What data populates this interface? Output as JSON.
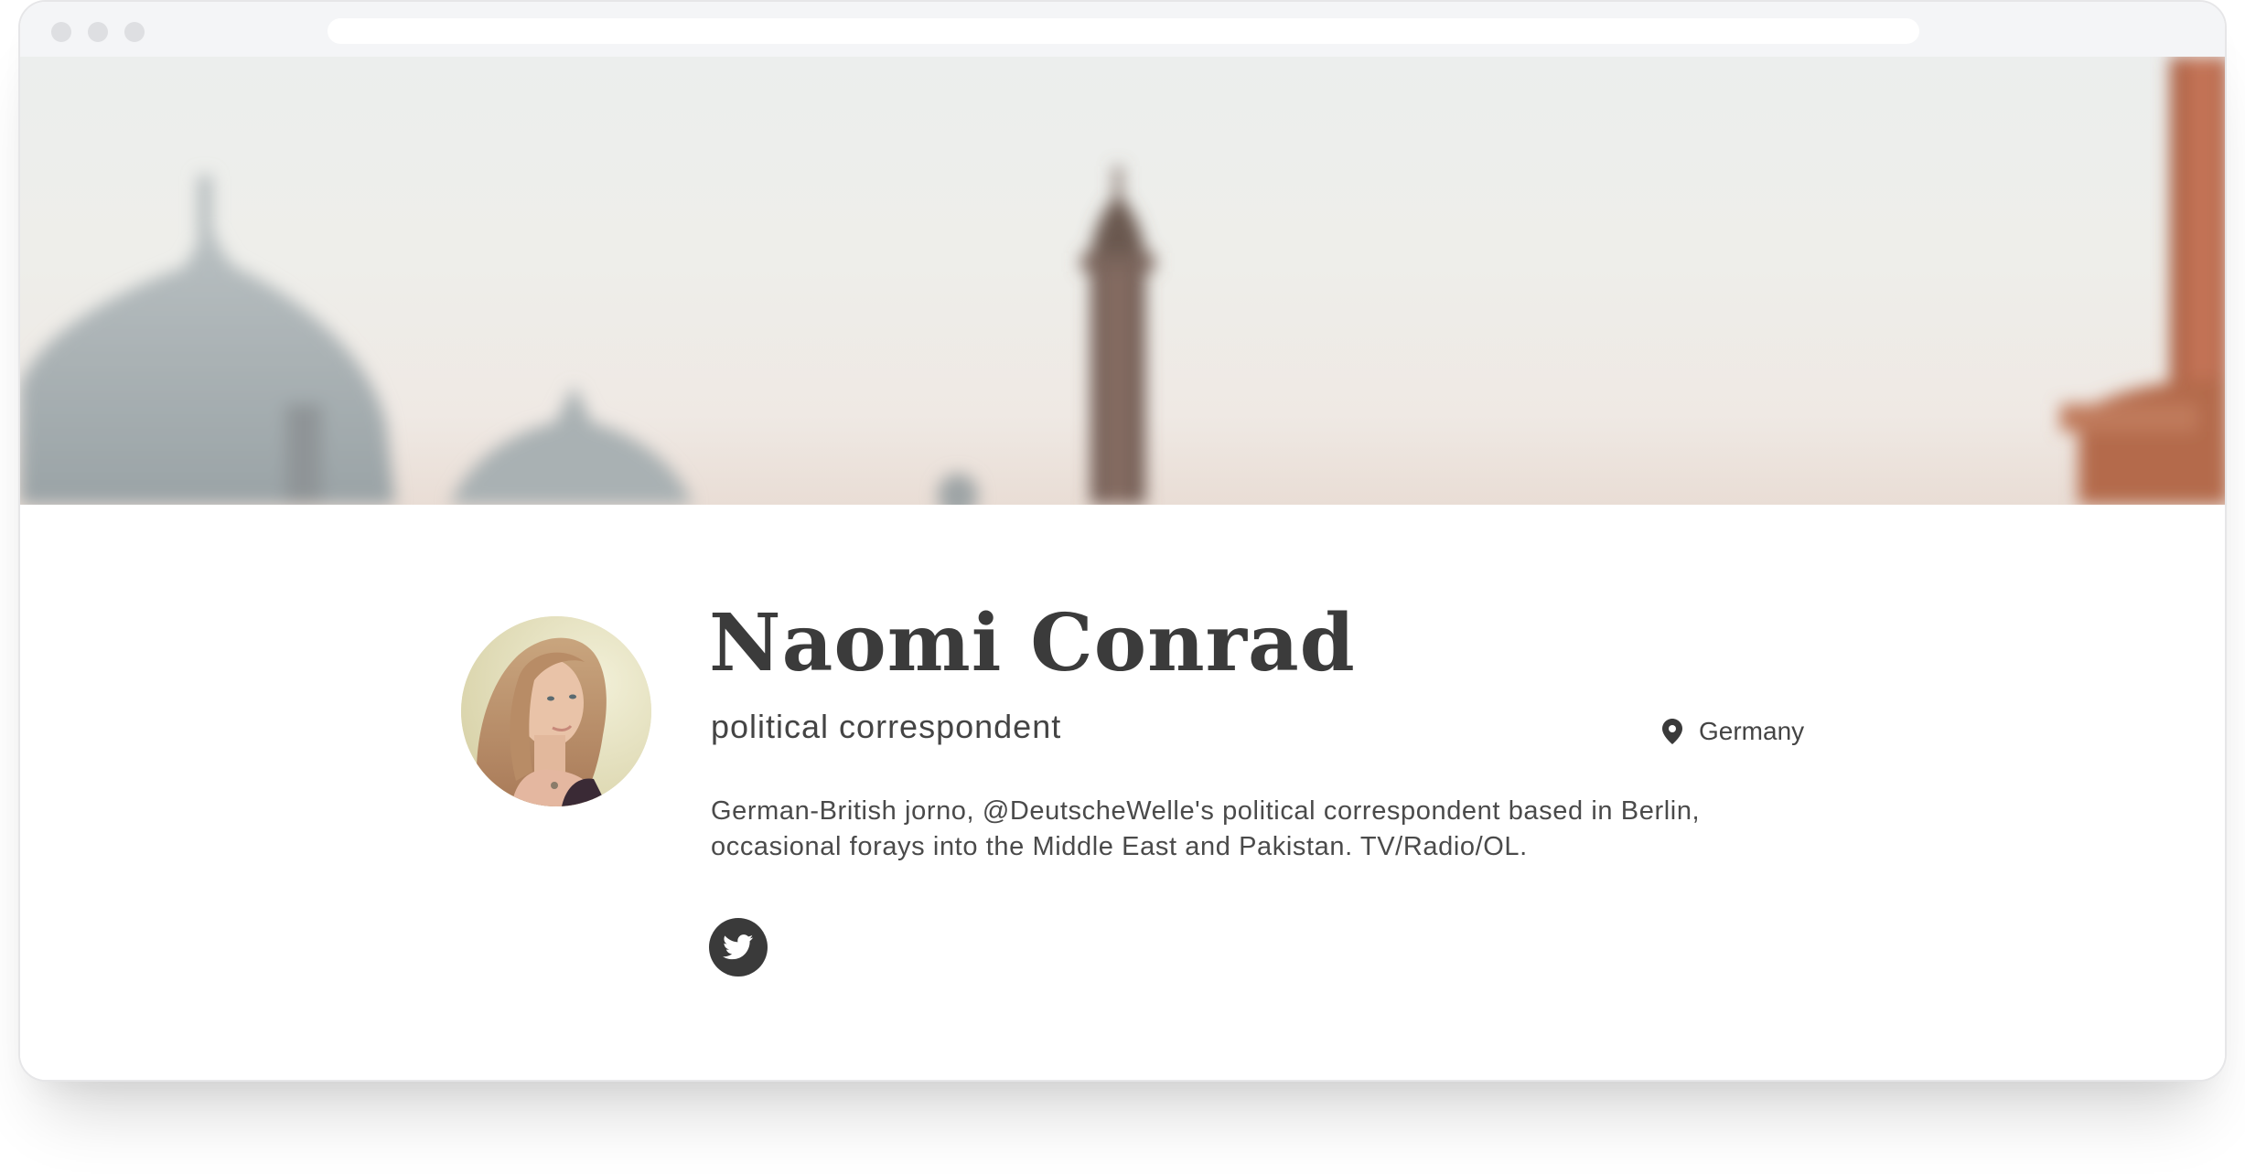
{
  "browser": {
    "controls": [
      "close-dot",
      "minimize-dot",
      "maximize-dot"
    ]
  },
  "cover": {
    "description_icon": "mosque-skyline-cover"
  },
  "profile": {
    "name": "Naomi Conrad",
    "role": "political correspondent",
    "location": "Germany",
    "bio_lines": [
      "German-British jorno, @DeutscheWelle's political correspondent based in Berlin,",
      "occasional forays into the Middle East and Pakistan. TV/Radio/OL."
    ],
    "social": [
      {
        "icon": "twitter-icon"
      }
    ]
  },
  "colors": {
    "text_dark": "#3b3b3b",
    "text_body": "#4a4a4a",
    "icon_bg": "#3a3a3a",
    "chrome": "#f4f5f7"
  }
}
